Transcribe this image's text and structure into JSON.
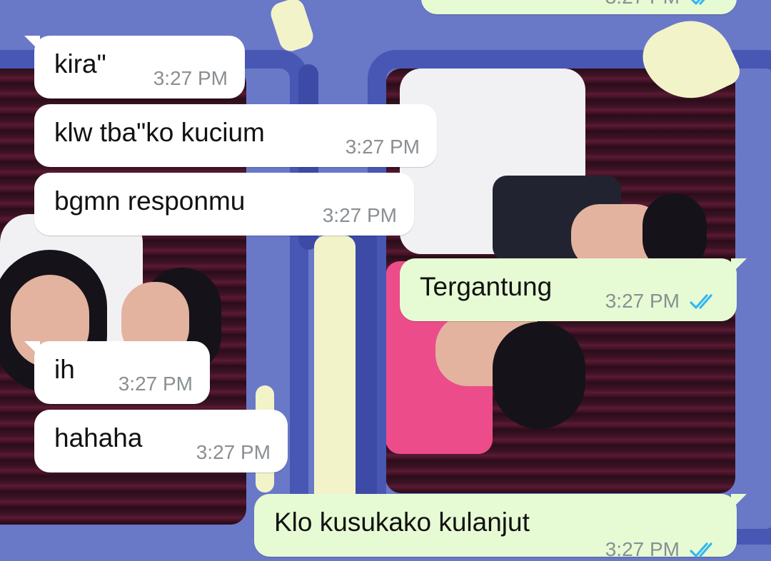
{
  "colors": {
    "incoming_bubble": "#ffffff",
    "outgoing_bubble": "#e6fbd4",
    "timestamp": "#8a8f93",
    "read_tick": "#34b7f1",
    "wallpaper_background": "#6a78c8"
  },
  "wallpaper": {
    "description_icon": "photo-booth-wallpaper"
  },
  "messages": [
    {
      "direction": "outgoing",
      "text": "",
      "time": "3:27 PM",
      "status": "read"
    },
    {
      "direction": "incoming",
      "text": "kira\"",
      "time": "3:27 PM"
    },
    {
      "direction": "incoming",
      "text": "klw tba\"ko kucium",
      "time": "3:27 PM"
    },
    {
      "direction": "incoming",
      "text": "bgmn responmu",
      "time": "3:27 PM"
    },
    {
      "direction": "outgoing",
      "text": "Tergantung",
      "time": "3:27 PM",
      "status": "read"
    },
    {
      "direction": "incoming",
      "text": "ih",
      "time": "3:27 PM"
    },
    {
      "direction": "incoming",
      "text": "hahaha",
      "time": "3:27 PM"
    },
    {
      "direction": "outgoing",
      "text": "Klo kusukako kulanjut",
      "time": "3:27 PM",
      "status": "read"
    }
  ]
}
